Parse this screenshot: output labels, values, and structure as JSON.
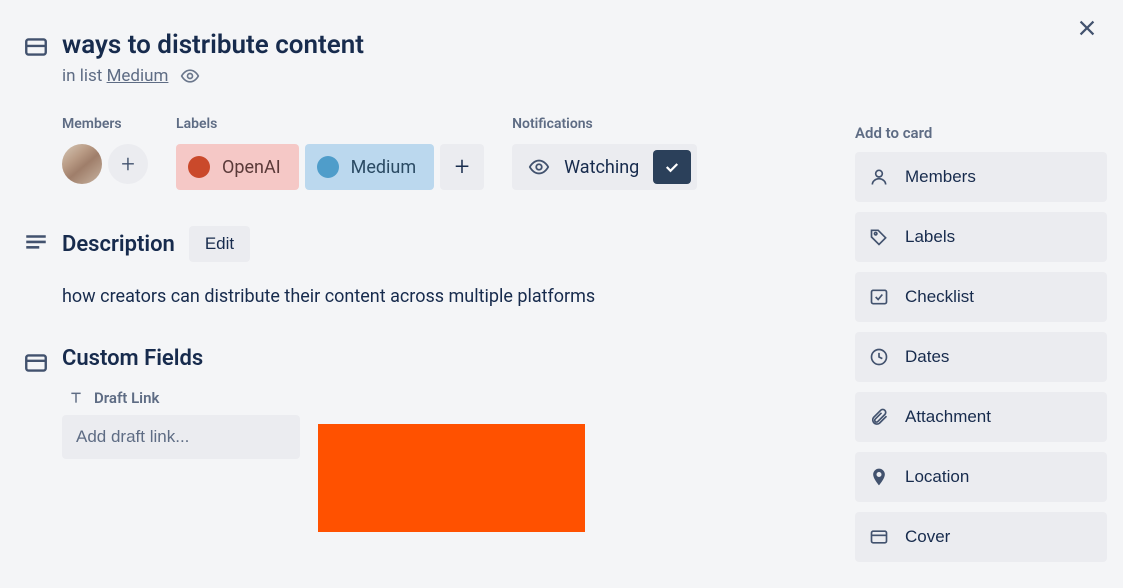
{
  "card": {
    "title": "ways to distribute content",
    "in_list_prefix": "in list ",
    "list_name": "Medium"
  },
  "members": {
    "heading": "Members"
  },
  "labels": {
    "heading": "Labels",
    "items": [
      {
        "name": "OpenAI",
        "style": "openai"
      },
      {
        "name": "Medium",
        "style": "medium"
      }
    ]
  },
  "notifications": {
    "heading": "Notifications",
    "state_label": "Watching"
  },
  "description": {
    "heading": "Description",
    "edit_label": "Edit",
    "text": "how creators can distribute their content across multiple platforms"
  },
  "custom_fields": {
    "heading": "Custom Fields",
    "fields": [
      {
        "label": "Draft Link",
        "placeholder": "Add draft link..."
      }
    ]
  },
  "sidebar": {
    "heading": "Add to card",
    "items": [
      {
        "icon": "user",
        "label": "Members"
      },
      {
        "icon": "tag",
        "label": "Labels"
      },
      {
        "icon": "checklist",
        "label": "Checklist"
      },
      {
        "icon": "clock",
        "label": "Dates"
      },
      {
        "icon": "attachment",
        "label": "Attachment"
      },
      {
        "icon": "location",
        "label": "Location"
      },
      {
        "icon": "cover",
        "label": "Cover"
      }
    ]
  }
}
